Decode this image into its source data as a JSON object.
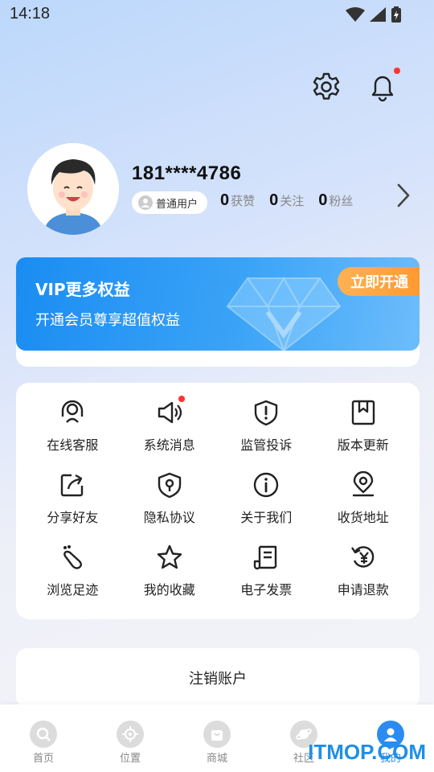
{
  "status_bar": {
    "time": "14:18"
  },
  "profile": {
    "phone": "181****4786",
    "badge": "普通用户",
    "stats": [
      {
        "num": "0",
        "label": "获赞"
      },
      {
        "num": "0",
        "label": "关注"
      },
      {
        "num": "0",
        "label": "粉丝"
      }
    ]
  },
  "vip": {
    "title": "VIP更多权益",
    "subtitle": "开通会员尊享超值权益",
    "button": "立即开通"
  },
  "menu": {
    "items": [
      {
        "label": "在线客服",
        "icon": "headset-icon"
      },
      {
        "label": "系统消息",
        "icon": "megaphone-icon"
      },
      {
        "label": "监管投诉",
        "icon": "shield-alert-icon"
      },
      {
        "label": "版本更新",
        "icon": "bookmark-icon"
      },
      {
        "label": "分享好友",
        "icon": "share-icon"
      },
      {
        "label": "隐私协议",
        "icon": "shield-lock-icon"
      },
      {
        "label": "关于我们",
        "icon": "info-icon"
      },
      {
        "label": "收货地址",
        "icon": "location-icon"
      },
      {
        "label": "浏览足迹",
        "icon": "footprint-icon"
      },
      {
        "label": "我的收藏",
        "icon": "star-icon"
      },
      {
        "label": "电子发票",
        "icon": "invoice-icon"
      },
      {
        "label": "申请退款",
        "icon": "refund-icon"
      }
    ]
  },
  "cancel_account": "注销账户",
  "nav": {
    "items": [
      {
        "label": "首页"
      },
      {
        "label": "位置"
      },
      {
        "label": "商城"
      },
      {
        "label": "社区"
      },
      {
        "label": "我的"
      }
    ]
  },
  "watermark": "ITMOP.COM",
  "colors": {
    "accent": "#2a8cf0",
    "vip_orange": "#ff9a2e",
    "badge_red": "#ff3333"
  }
}
